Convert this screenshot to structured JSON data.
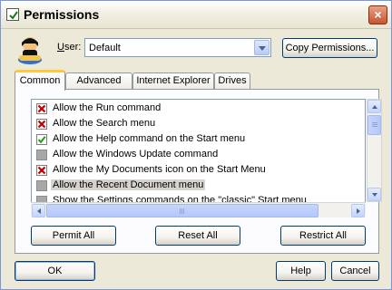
{
  "window": {
    "title": "Permissions",
    "close_symbol": "×"
  },
  "user": {
    "label_accel": "U",
    "label_rest": "ser:",
    "value": "Default"
  },
  "buttons": {
    "copy_permissions": "Copy Permissions...",
    "permit_all": "Permit All",
    "reset_all": "Reset All",
    "restrict_all": "Restrict All",
    "ok": "OK",
    "help": "Help",
    "cancel": "Cancel"
  },
  "tabs": [
    "Common",
    "Advanced",
    "Internet Explorer",
    "Drives"
  ],
  "active_tab": "Common",
  "permissions": [
    {
      "label": "Allow the Run command",
      "state": "restricted"
    },
    {
      "label": "Allow the Search menu",
      "state": "restricted"
    },
    {
      "label": "Allow the Help command on the Start menu",
      "state": "permitted"
    },
    {
      "label": "Allow the Windows Update command",
      "state": "default"
    },
    {
      "label": "Allow the My Documents icon on the Start Menu",
      "state": "restricted"
    },
    {
      "label": "Allow the Recent Document menu",
      "state": "default",
      "selected": true
    },
    {
      "label": "Show the Settings commands on the \"classic\" Start menu",
      "state": "default"
    }
  ],
  "colors": {
    "restricted": "#c00000",
    "permitted": "#2b9a1b",
    "default": "#a8a8a8"
  }
}
